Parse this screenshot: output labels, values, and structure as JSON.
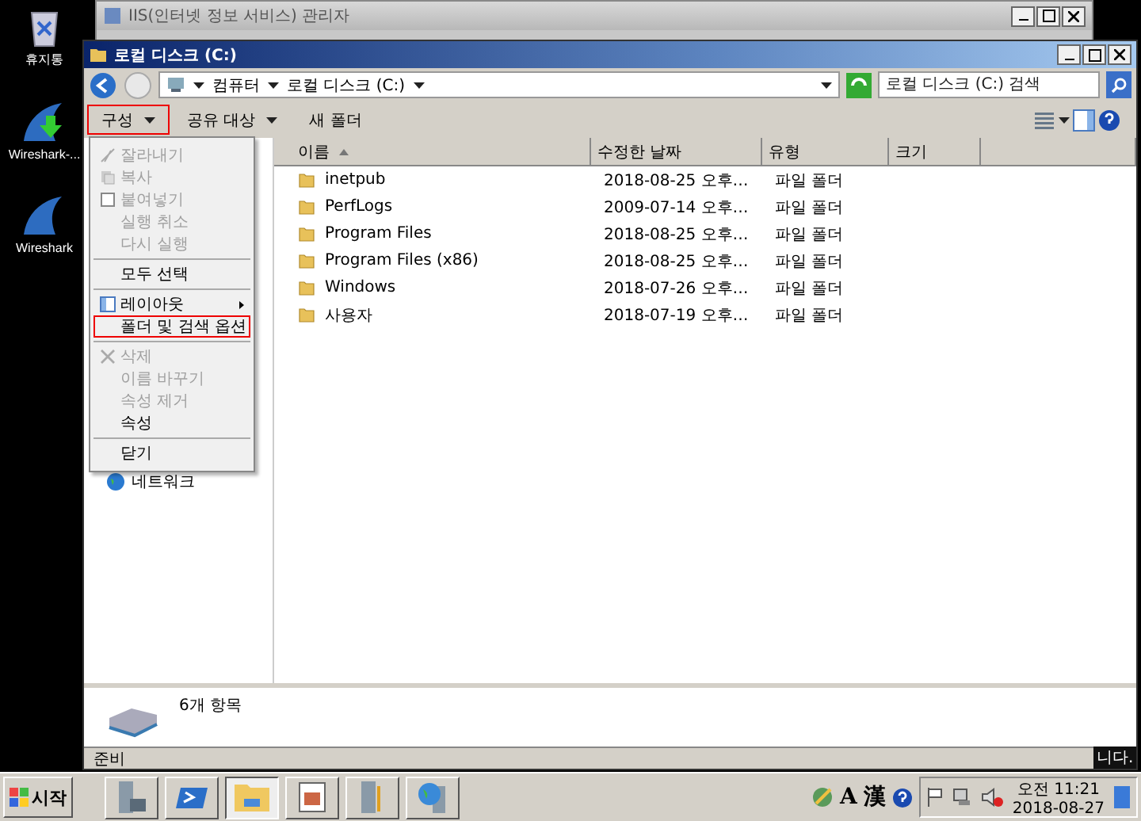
{
  "desktop": {
    "icons": [
      {
        "label": "휴지통",
        "kind": "trash"
      },
      {
        "label": "Wireshark-...",
        "kind": "download"
      },
      {
        "label": "Wireshark",
        "kind": "fin"
      }
    ]
  },
  "background_window": {
    "title": "IIS(인터넷 정보 서비스) 관리자",
    "status_text": "니다."
  },
  "window": {
    "title": "로컬 디스크 (C:)"
  },
  "address": {
    "crumbs": [
      "컴퓨터",
      "로컬 디스크 (C:)"
    ]
  },
  "search": {
    "placeholder": "로컬 디스크 (C:) 검색"
  },
  "toolbar": [
    {
      "label": "구성",
      "dropdown": true,
      "outlined": true
    },
    {
      "label": "공유 대상",
      "dropdown": true,
      "outlined": false
    },
    {
      "label": "새 폴더",
      "dropdown": false,
      "outlined": false
    }
  ],
  "menu": {
    "groups": [
      [
        {
          "label": "잘라내기",
          "kind": "cut",
          "disabled": true,
          "submenu": false,
          "outlined": false
        },
        {
          "label": "복사",
          "kind": "copy",
          "disabled": true,
          "submenu": false,
          "outlined": false
        },
        {
          "label": "붙여넣기",
          "kind": "paste",
          "disabled": true,
          "submenu": false,
          "outlined": false
        },
        {
          "label": "실행 취소",
          "kind": "plain",
          "disabled": true,
          "submenu": false,
          "outlined": false
        },
        {
          "label": "다시 실행",
          "kind": "plain",
          "disabled": true,
          "submenu": false,
          "outlined": false
        }
      ],
      [
        {
          "label": "모두 선택",
          "kind": "plain",
          "disabled": false,
          "submenu": false,
          "outlined": false
        }
      ],
      [
        {
          "label": "레이아웃",
          "kind": "layout",
          "disabled": false,
          "submenu": true,
          "outlined": false
        },
        {
          "label": "폴더 및 검색 옵션",
          "kind": "plain",
          "disabled": false,
          "submenu": false,
          "outlined": true
        }
      ],
      [
        {
          "label": "삭제",
          "kind": "delete",
          "disabled": true,
          "submenu": false,
          "outlined": false
        },
        {
          "label": "이름 바꾸기",
          "kind": "plain",
          "disabled": true,
          "submenu": false,
          "outlined": false
        },
        {
          "label": "속성 제거",
          "kind": "plain",
          "disabled": true,
          "submenu": false,
          "outlined": false
        },
        {
          "label": "속성",
          "kind": "plain",
          "disabled": false,
          "submenu": false,
          "outlined": false
        }
      ],
      [
        {
          "label": "닫기",
          "kind": "plain",
          "disabled": false,
          "submenu": false,
          "outlined": false
        }
      ]
    ]
  },
  "nav": {
    "items": [
      {
        "label": "네트워크"
      }
    ]
  },
  "table": {
    "columns": [
      {
        "label": "이름",
        "sorted": true
      },
      {
        "label": "수정한 날짜",
        "sorted": false
      },
      {
        "label": "유형",
        "sorted": false
      },
      {
        "label": "크기",
        "sorted": false
      }
    ],
    "rows": [
      {
        "name": "inetpub",
        "modified": "2018-08-25 오후…",
        "type": "파일 폴더"
      },
      {
        "name": "PerfLogs",
        "modified": "2009-07-14 오후…",
        "type": "파일 폴더"
      },
      {
        "name": "Program Files",
        "modified": "2018-08-25 오후…",
        "type": "파일 폴더"
      },
      {
        "name": "Program Files (x86)",
        "modified": "2018-08-25 오후…",
        "type": "파일 폴더"
      },
      {
        "name": "Windows",
        "modified": "2018-07-26 오후…",
        "type": "파일 폴더"
      },
      {
        "name": "사용자",
        "modified": "2018-07-19 오후…",
        "type": "파일 폴더"
      }
    ]
  },
  "details": {
    "text": "6개 항목"
  },
  "status_bar": "준비",
  "taskbar": {
    "start": "시작",
    "apps": [
      {
        "kind": "server",
        "selected": false
      },
      {
        "kind": "terminal",
        "selected": false
      },
      {
        "kind": "folder",
        "selected": true
      },
      {
        "kind": "window",
        "selected": false
      },
      {
        "kind": "tools",
        "selected": false
      },
      {
        "kind": "globe",
        "selected": false
      }
    ],
    "ime": [
      "A",
      "漢"
    ],
    "time": "오전 11:21",
    "date": "2018-08-27"
  }
}
